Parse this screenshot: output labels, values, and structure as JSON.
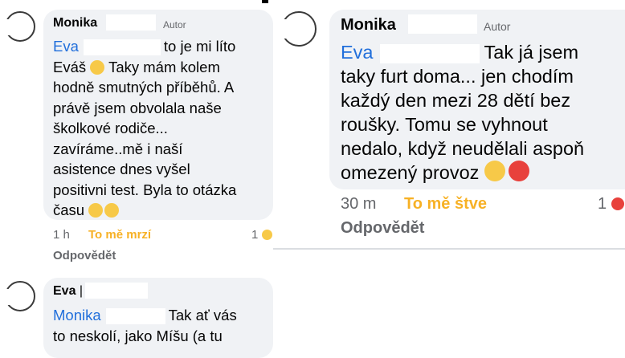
{
  "comment_left": {
    "author": "Monika",
    "badge": "Autor",
    "mention": "Eva",
    "text_lines": [
      "to je mi líto",
      "Eváš",
      "Taky mám kolem",
      "hodně smutných příběhů. A",
      "právě jsem obvolala naše",
      "školkové rodiče...",
      "zavíráme..mě i naší",
      "asistence dnes vyšel",
      "positivni test. Byla to otázka",
      "času"
    ],
    "time": "1 h",
    "reaction_label": "To mě mrzí",
    "reaction_count": "1",
    "reply_label": "Odpovědět"
  },
  "comment_right": {
    "author": "Monika",
    "badge": "Autor",
    "mention": "Eva",
    "text_lines": [
      "Tak já jsem",
      "taky furt doma... jen chodím",
      "každý den mezi 28 dětí bez",
      "roušky. Tomu se vyhnout",
      "nedalo, když neudělali aspoň",
      "omezený provoz"
    ],
    "time": "30 m",
    "reaction_label": "To mě štve",
    "reaction_count": "1",
    "reply_label": "Odpovědět"
  },
  "comment_bottom": {
    "author": "Eva",
    "mention": "Monika",
    "text_lines": [
      "Tak ať vás",
      "to neskolí, jako Míšu (a tu"
    ]
  },
  "colors": {
    "mention": "#216fdb",
    "reaction_sad": "#f7b125",
    "reaction_angry": "#e8413c",
    "bubble": "#f0f2f5"
  },
  "icons": [
    "sad-face-emoji",
    "angry-face-emoji",
    "avatar-placeholder"
  ]
}
